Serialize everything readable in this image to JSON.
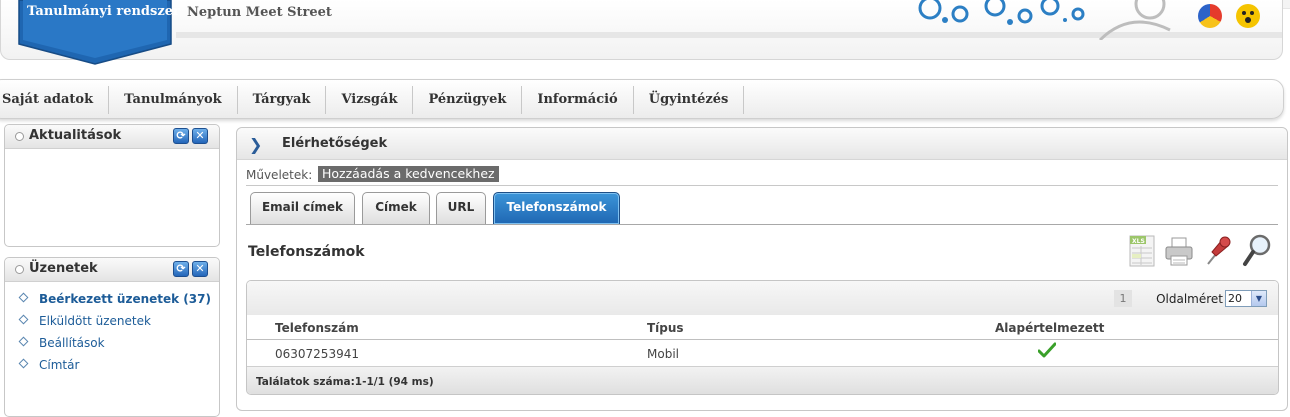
{
  "header": {
    "logo_text": "Tanulmányi rendszer",
    "site_name": "Neptun Meet Street"
  },
  "menu": {
    "items": [
      "Saját adatok",
      "Tanulmányok",
      "Tárgyak",
      "Vizsgák",
      "Pénzügyek",
      "Információ",
      "Ügyintézés"
    ]
  },
  "left_panels": {
    "news": {
      "title": "Aktualitások"
    },
    "messages": {
      "title": "Üzenetek",
      "items": [
        "Beérkezett üzenetek (37)",
        "Elküldött üzenetek",
        "Beállítások",
        "Címtár"
      ]
    }
  },
  "main": {
    "title": "Elérhetőségek",
    "operations_label": "Műveletek:",
    "add_favorite": "Hozzáadás a kedvencekhez",
    "tabs": [
      "Email címek",
      "Címek",
      "URL",
      "Telefonszámok"
    ],
    "active_tab": "Telefonszámok",
    "section_title": "Telefonszámok",
    "toolbar_icons": [
      "excel-export-icon",
      "printer-icon",
      "pin-icon",
      "search-icon"
    ],
    "grid": {
      "page_number": "1",
      "page_size_label": "Oldalméret",
      "page_size": "20",
      "columns": [
        "Telefonszám",
        "Típus",
        "Alapértelmezett"
      ],
      "rows": [
        {
          "phone": "06307253941",
          "type": "Mobil",
          "default": true
        }
      ],
      "footer": "Találatok száma:1-1/1 (94 ms)"
    }
  },
  "colors": {
    "accent_blue": "#1f67b3",
    "link_blue": "#1d5c98",
    "check_green": "#3aa02a"
  }
}
